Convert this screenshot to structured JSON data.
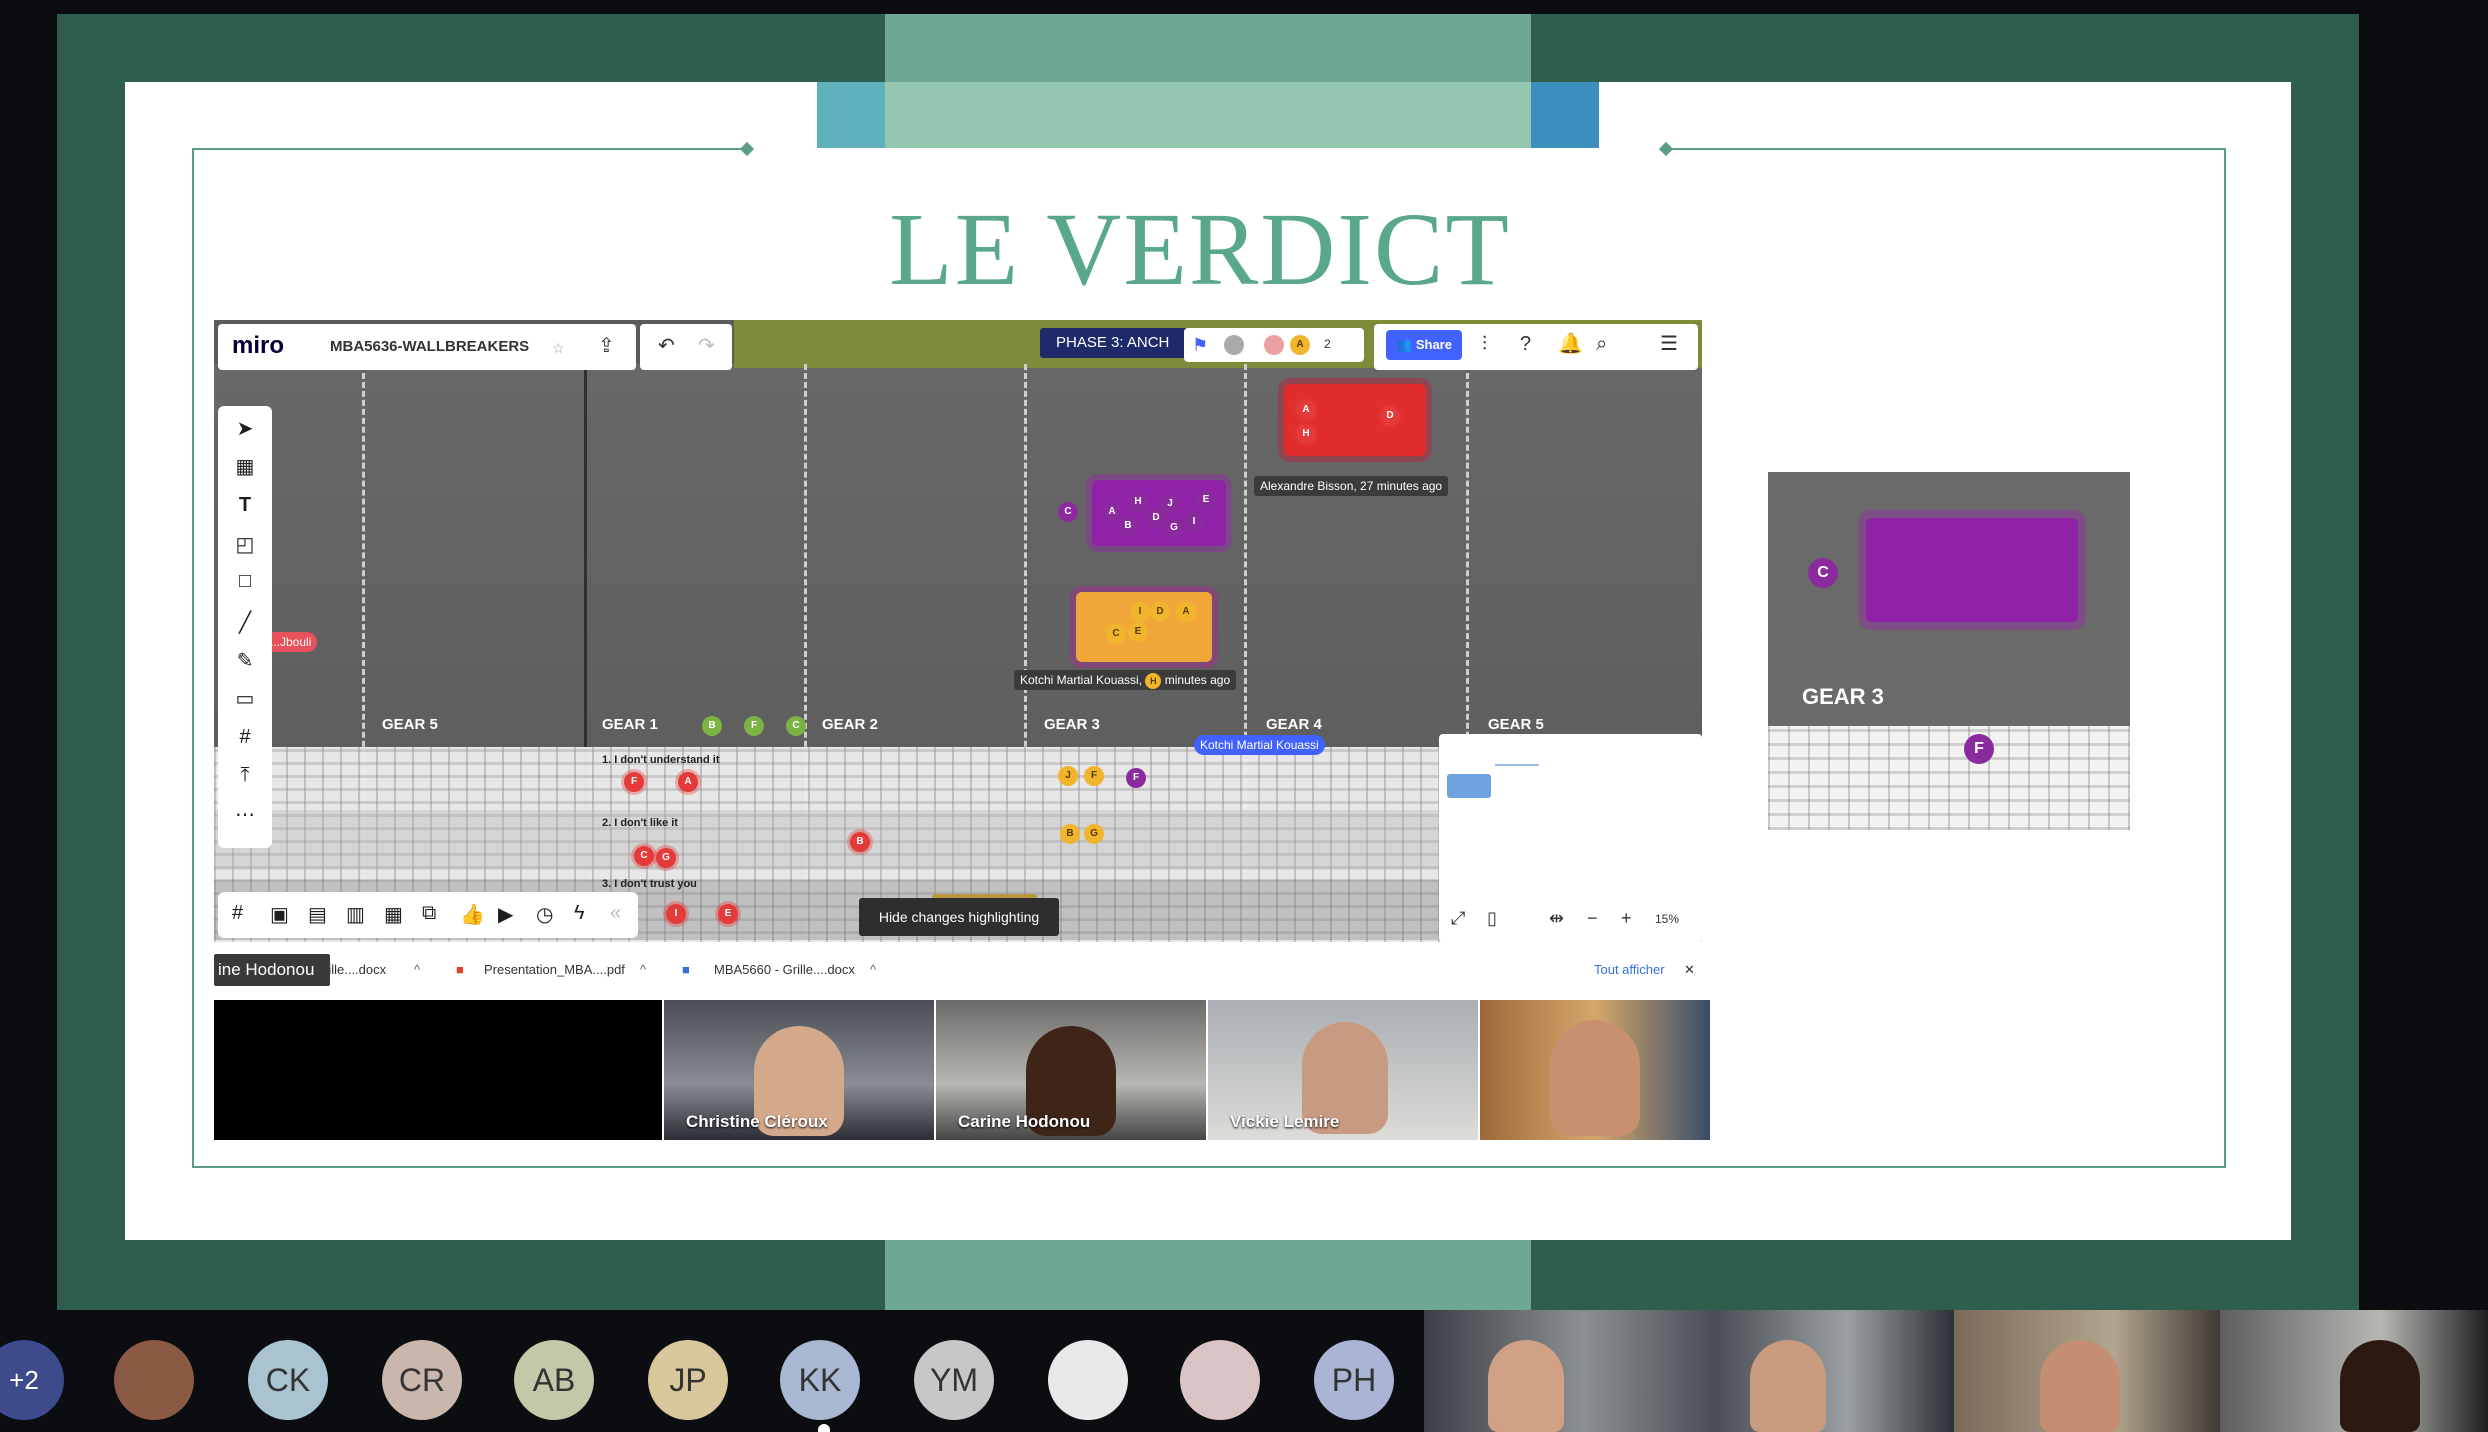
{
  "slide": {
    "title": "LE VERDICT"
  },
  "miro": {
    "logo": "miro",
    "board_name": "MBA5636-WALLBREAKERS",
    "phase": "PHASE 3: ANCH",
    "avatar_count": "2",
    "share_label": "Share",
    "gears": [
      "GEAR 5",
      "GEAR 1",
      "GEAR 2",
      "GEAR 3",
      "GEAR 4",
      "GEAR 5"
    ],
    "rows": [
      "1. I don't understand it",
      "2. I don't like it",
      "3. I don't trust you"
    ],
    "tag_red": "...Jbouli",
    "tag_bisson": "Alexandre Bisson, 27 minutes ago",
    "tag_kouassi_a": "Kotchi Martial Kouassi,",
    "tag_kouassi_b": "minutes ago",
    "cursor_kouassi": "Kotchi Martial Kouassi",
    "cursor_name_dim": "Alexandre Bisson",
    "hide_changes": "Hide changes highlighting",
    "zoom_level": "15%",
    "red_bus_letters": [
      "A",
      "D",
      "H"
    ],
    "purple_bus_letters": [
      "A",
      "B",
      "H",
      "D",
      "J",
      "G",
      "E",
      "I"
    ],
    "yellow_bus_letters": [
      "I",
      "D",
      "A",
      "C",
      "E"
    ],
    "zoom_gear_label": "GEAR 3"
  },
  "downloads": {
    "name_pill": "ine Hodonou",
    "items": [
      "rille....docx",
      "Presentation_MBA....pdf",
      "MBA5660 - Grille....docx"
    ],
    "show_all": "Tout afficher",
    "close": "✕"
  },
  "video_tiles": [
    {
      "name": ""
    },
    {
      "name": "Christine Cléroux"
    },
    {
      "name": "Carine Hodonou"
    },
    {
      "name": "Vickie Lemire"
    },
    {
      "name": ""
    }
  ],
  "participants": {
    "more": "+2",
    "initials": [
      "CK",
      "CR",
      "AB",
      "JP",
      "KK",
      "YM",
      "PH"
    ]
  },
  "colors": {
    "frame": "#2f5d4e",
    "accent_teal": "#6ea894",
    "title": "#5aa88a",
    "miro_share": "#4262ff"
  }
}
